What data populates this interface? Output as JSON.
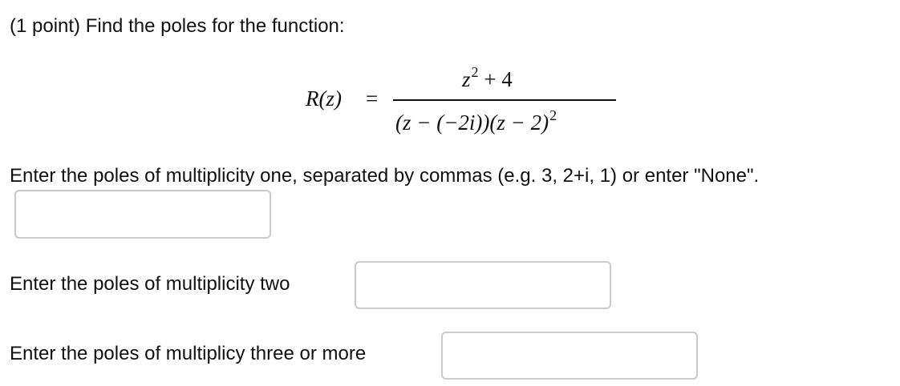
{
  "problem": {
    "header": "(1 point) Find the poles for the function:",
    "formula": {
      "lhs": "R(z)",
      "equals": "=",
      "numerator_base": "z",
      "numerator_exp": "2",
      "numerator_rest": "+ 4",
      "denominator_main": "(z − (−2i))(z − 2)",
      "denominator_exp": "2"
    },
    "instruction_one": "Enter the poles of multiplicity one, separated by commas (e.g. 3, 2+i, 1) or enter \"None\".",
    "label_two": "Enter the poles of multiplicity two",
    "label_three": "Enter the poles of multiplicy three or more"
  },
  "answers": {
    "multiplicity_one": "",
    "multiplicity_two": "",
    "multiplicity_three": ""
  }
}
